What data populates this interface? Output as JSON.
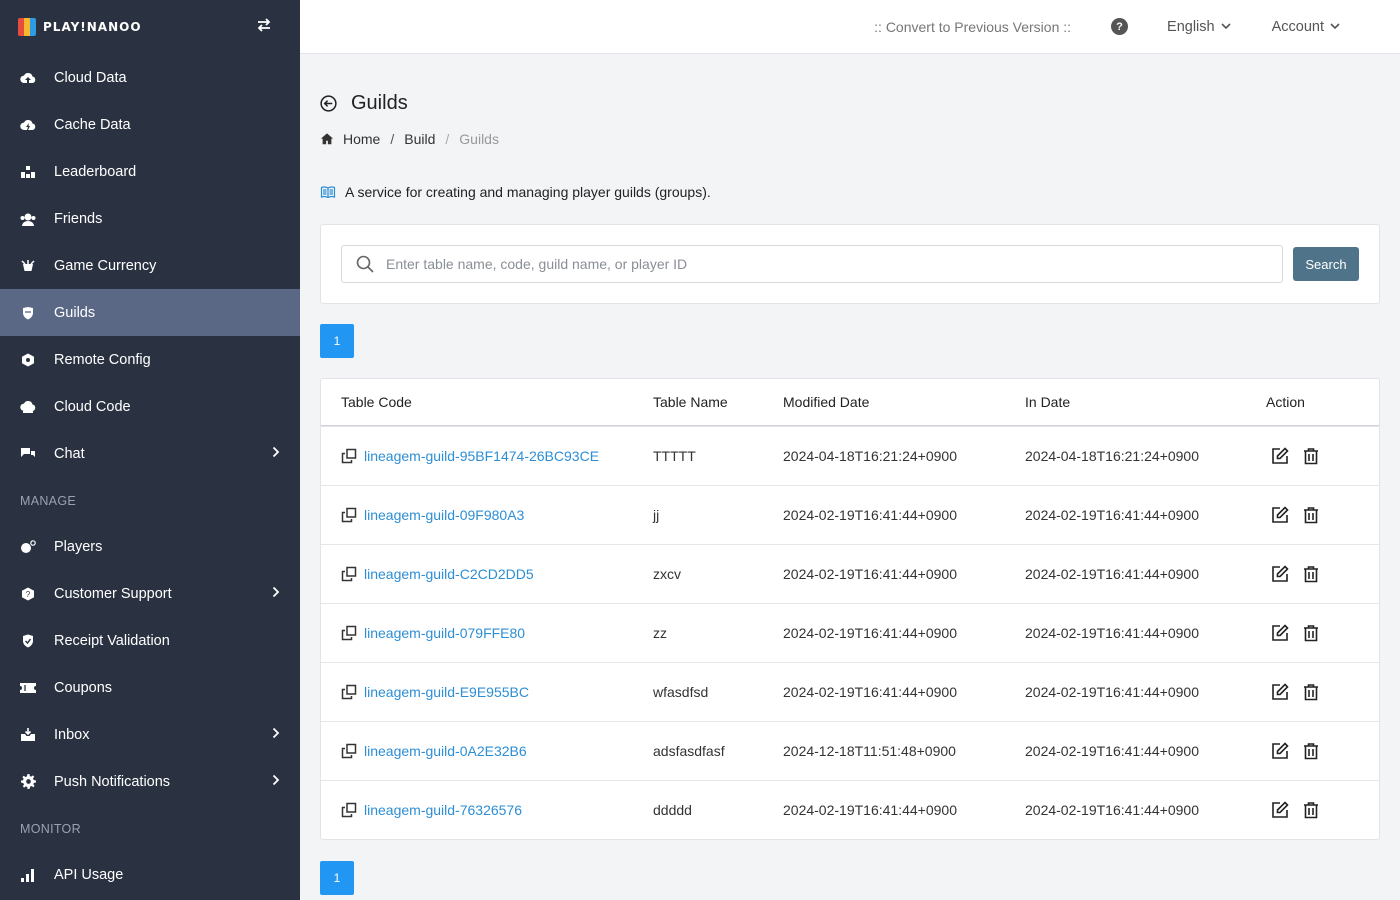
{
  "brand": {
    "name": "PLAY!NANOO"
  },
  "sidebar": {
    "items": [
      {
        "label": "Cloud Data",
        "icon": "cloud-upload-icon"
      },
      {
        "label": "Cache Data",
        "icon": "cloud-bolt-icon"
      },
      {
        "label": "Leaderboard",
        "icon": "leaderboard-icon"
      },
      {
        "label": "Friends",
        "icon": "friends-icon"
      },
      {
        "label": "Game Currency",
        "icon": "currency-icon"
      },
      {
        "label": "Guilds",
        "icon": "guild-shield-icon",
        "active": true
      },
      {
        "label": "Remote Config",
        "icon": "remote-config-icon"
      },
      {
        "label": "Cloud Code",
        "icon": "cloud-code-icon"
      },
      {
        "label": "Chat",
        "icon": "chat-icon",
        "submenu": true
      }
    ],
    "manage_label": "MANAGE",
    "manage_items": [
      {
        "label": "Players",
        "icon": "players-icon"
      },
      {
        "label": "Customer Support",
        "icon": "support-icon",
        "submenu": true
      },
      {
        "label": "Receipt Validation",
        "icon": "receipt-shield-icon"
      },
      {
        "label": "Coupons",
        "icon": "coupon-icon"
      },
      {
        "label": "Inbox",
        "icon": "inbox-icon",
        "submenu": true
      },
      {
        "label": "Push Notifications",
        "icon": "gear-icon",
        "submenu": true
      }
    ],
    "monitor_label": "MONITOR",
    "monitor_items": [
      {
        "label": "API Usage",
        "icon": "bar-chart-icon"
      }
    ]
  },
  "topbar": {
    "convert": ":: Convert to Previous Version ::",
    "help": "?",
    "language": "English",
    "account": "Account"
  },
  "page": {
    "title": "Guilds",
    "breadcrumb": {
      "home": "Home",
      "sep1": "/",
      "build": "Build",
      "sep2": "/",
      "current": "Guilds"
    },
    "description": "A service for creating and managing player guilds (groups)."
  },
  "search": {
    "placeholder": "Enter table name, code, guild name, or player ID",
    "button": "Search"
  },
  "pagination": {
    "page": "1"
  },
  "table": {
    "headers": [
      "Table Code",
      "Table Name",
      "Modified Date",
      "In Date",
      "Action"
    ],
    "rows": [
      {
        "code": "lineagem-guild-95BF1474-26BC93CE",
        "name": "TTTTT",
        "modified": "2024-04-18T16:21:24+0900",
        "indate": "2024-04-18T16:21:24+0900"
      },
      {
        "code": "lineagem-guild-09F980A3",
        "name": "jj",
        "modified": "2024-02-19T16:41:44+0900",
        "indate": "2024-02-19T16:41:44+0900"
      },
      {
        "code": "lineagem-guild-C2CD2DD5",
        "name": "zxcv",
        "modified": "2024-02-19T16:41:44+0900",
        "indate": "2024-02-19T16:41:44+0900"
      },
      {
        "code": "lineagem-guild-079FFE80",
        "name": "zz",
        "modified": "2024-02-19T16:41:44+0900",
        "indate": "2024-02-19T16:41:44+0900"
      },
      {
        "code": "lineagem-guild-E9E955BC",
        "name": "wfasdfsd",
        "modified": "2024-02-19T16:41:44+0900",
        "indate": "2024-02-19T16:41:44+0900"
      },
      {
        "code": "lineagem-guild-0A2E32B6",
        "name": "adsfasdfasf",
        "modified": "2024-12-18T11:51:48+0900",
        "indate": "2024-02-19T16:41:44+0900"
      },
      {
        "code": "lineagem-guild-76326576",
        "name": "ddddd",
        "modified": "2024-02-19T16:41:44+0900",
        "indate": "2024-02-19T16:41:44+0900"
      }
    ]
  },
  "colors": {
    "sidebar_bg": "#2a3140",
    "sidebar_active": "#5a6886",
    "link": "#2d8ed4",
    "primary": "#2196f3",
    "search_button": "#4f7389"
  }
}
